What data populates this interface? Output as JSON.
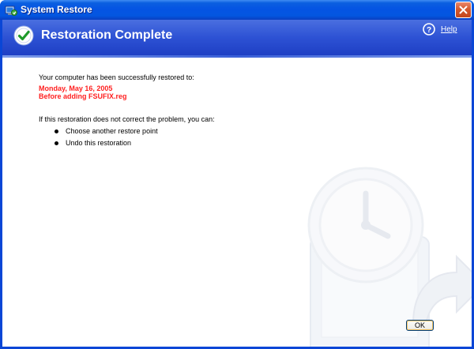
{
  "window": {
    "title": "System Restore",
    "title_icon": "system-restore-icon",
    "close_icon": "close-icon"
  },
  "header": {
    "title": "Restoration Complete",
    "status_icon": "check-icon",
    "help_icon": "help-icon",
    "help_label": "Help"
  },
  "content": {
    "intro": "Your computer has been successfully restored to:",
    "restore_date": "Monday, May 16, 2005",
    "restore_description": "Before adding FSUFIX.reg",
    "problem_text": "If this restoration does not correct the problem, you can:",
    "options": [
      "Choose another restore point",
      "Undo this restoration"
    ]
  },
  "footer": {
    "ok_label": "OK"
  },
  "colors": {
    "titlebar": "#0554e3",
    "header": "#2d52d4",
    "highlight_text": "#ff2020",
    "close_button": "#d45a2e"
  }
}
